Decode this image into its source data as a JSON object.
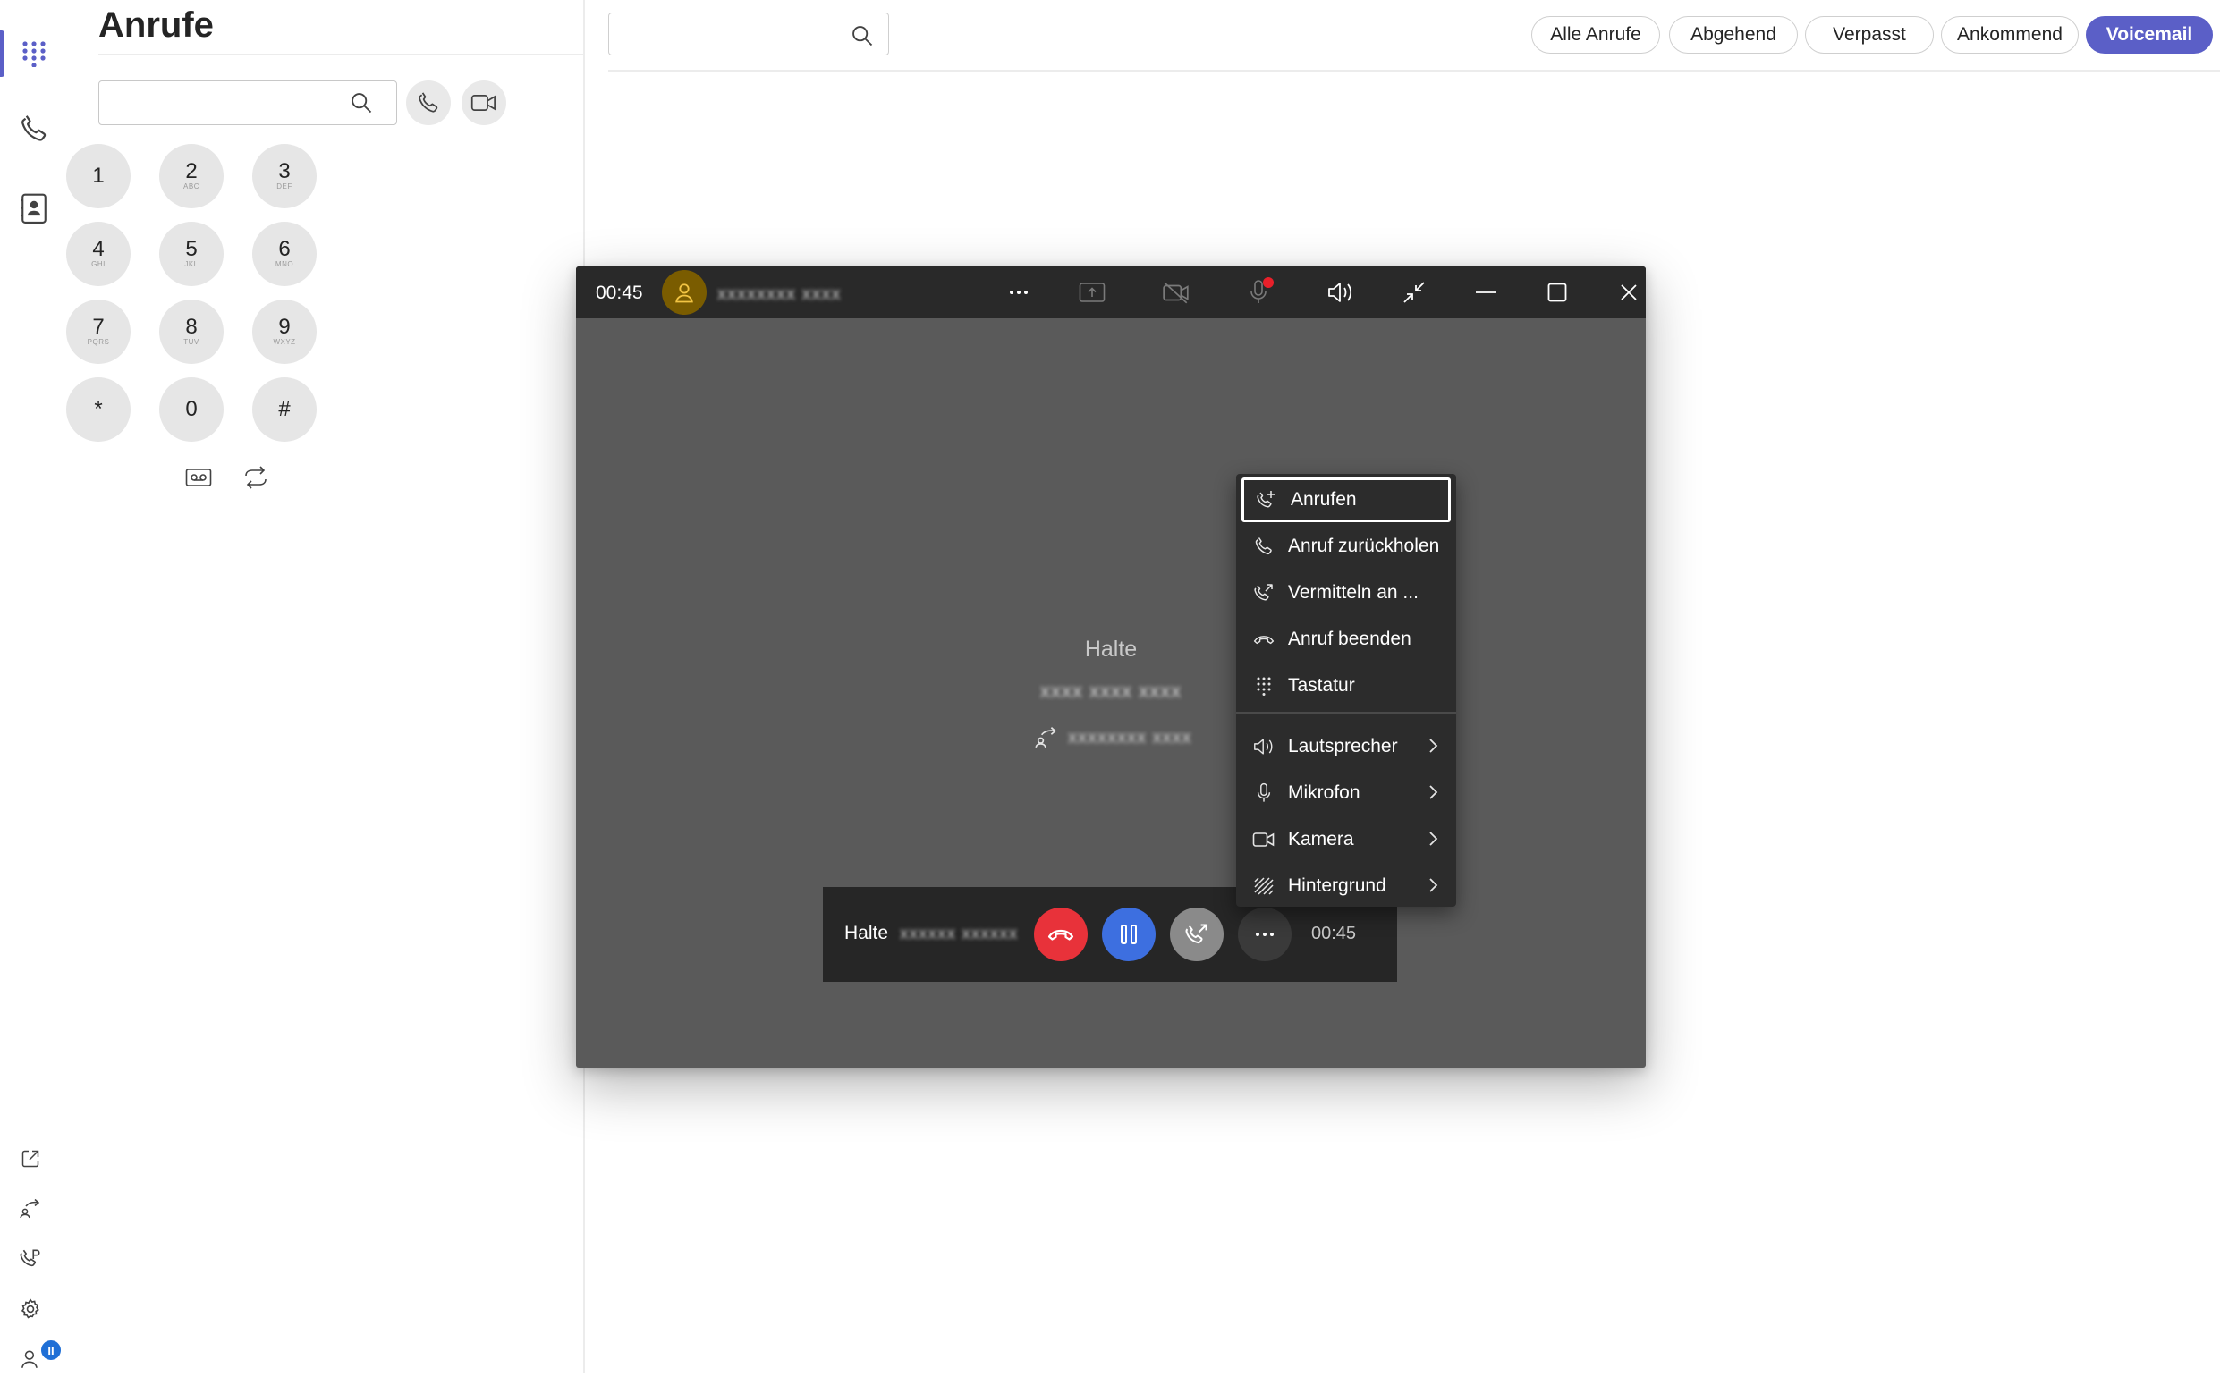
{
  "page": {
    "title": "Anrufe"
  },
  "rail": {
    "items": [
      {
        "name": "dialpad",
        "icon": "dialpad-icon",
        "active": true
      },
      {
        "name": "calls",
        "icon": "phone-icon"
      },
      {
        "name": "contacts",
        "icon": "contacts-icon"
      }
    ],
    "bottom_items": [
      {
        "name": "open-external",
        "icon": "open-external-icon"
      },
      {
        "name": "call-forwarding",
        "icon": "forward-person-icon"
      },
      {
        "name": "call-park",
        "icon": "call-park-icon"
      },
      {
        "name": "settings",
        "icon": "gear-icon"
      },
      {
        "name": "presence",
        "icon": "person-icon"
      }
    ],
    "badge": "II"
  },
  "dialer": {
    "input_value": "",
    "keys": [
      {
        "digit": "1",
        "letters": ""
      },
      {
        "digit": "2",
        "letters": "ABC"
      },
      {
        "digit": "3",
        "letters": "DEF"
      },
      {
        "digit": "4",
        "letters": "GHI"
      },
      {
        "digit": "5",
        "letters": "JKL"
      },
      {
        "digit": "6",
        "letters": "MNO"
      },
      {
        "digit": "7",
        "letters": "PQRS"
      },
      {
        "digit": "8",
        "letters": "TUV"
      },
      {
        "digit": "9",
        "letters": "WXYZ"
      },
      {
        "digit": "*",
        "letters": ""
      },
      {
        "digit": "0",
        "letters": ""
      },
      {
        "digit": "#",
        "letters": ""
      }
    ]
  },
  "main": {
    "search_value": "",
    "filters": [
      {
        "label": "Alle Anrufe",
        "active": false
      },
      {
        "label": "Abgehend",
        "active": false
      },
      {
        "label": "Verpasst",
        "active": false
      },
      {
        "label": "Ankommend",
        "active": false
      },
      {
        "label": "Voicemail",
        "active": true
      }
    ]
  },
  "call_window": {
    "timer": "00:45",
    "caller_name": "xxxxxxxx xxxx",
    "hold_label": "Halte",
    "hold_name": "xxxx xxxx xxxx",
    "transfer_name": "xxxxxxxx xxxx",
    "control_bar": {
      "hold_label": "Halte",
      "name": "xxxxxx xxxxxx",
      "timer": "00:45"
    }
  },
  "menu": {
    "items": [
      {
        "label": "Anrufen",
        "icon": "phone-add-icon",
        "focused": true
      },
      {
        "label": "Anruf zurückholen",
        "icon": "phone-icon"
      },
      {
        "label": "Vermitteln an ...",
        "icon": "phone-transfer-icon"
      },
      {
        "label": "Anruf beenden",
        "icon": "hang-up-icon"
      },
      {
        "label": "Tastatur",
        "icon": "dialpad-icon"
      }
    ],
    "submenus": [
      {
        "label": "Lautsprecher",
        "icon": "speaker-icon"
      },
      {
        "label": "Mikrofon",
        "icon": "microphone-icon"
      },
      {
        "label": "Kamera",
        "icon": "camera-icon"
      },
      {
        "label": "Hintergrund",
        "icon": "background-icon"
      }
    ]
  },
  "colors": {
    "accent": "#5b5fc7",
    "end_call": "#e8323a",
    "hold": "#3d6fe0",
    "call_window_bg": "#5a5a5a",
    "titlebar_bg": "#292929",
    "avatar_bg": "#7a5c00"
  }
}
